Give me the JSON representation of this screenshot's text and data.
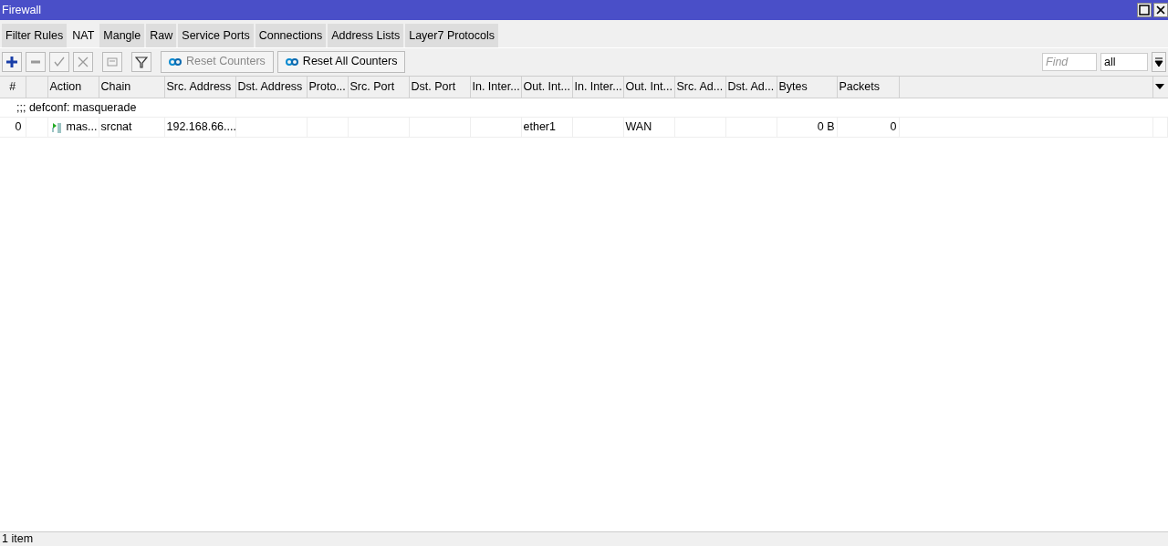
{
  "window": {
    "title": "Firewall"
  },
  "tabs": [
    {
      "label": "Filter Rules",
      "selected": false
    },
    {
      "label": "NAT",
      "selected": true
    },
    {
      "label": "Mangle",
      "selected": false
    },
    {
      "label": "Raw",
      "selected": false
    },
    {
      "label": "Service Ports",
      "selected": false
    },
    {
      "label": "Connections",
      "selected": false
    },
    {
      "label": "Address Lists",
      "selected": false
    },
    {
      "label": "Layer7 Protocols",
      "selected": false
    }
  ],
  "toolbar": {
    "tools": [
      {
        "kind": "add",
        "disabled": false
      },
      {
        "kind": "remove",
        "disabled": true
      },
      {
        "kind": "enable",
        "disabled": true
      },
      {
        "kind": "disable",
        "disabled": true
      },
      {
        "kind": "comment",
        "disabled": true
      },
      {
        "kind": "filter",
        "disabled": false
      }
    ],
    "buttons": [
      {
        "label": "Reset Counters",
        "disabled": true
      },
      {
        "label": "Reset All Counters",
        "disabled": false
      }
    ],
    "find": {
      "placeholder": "Find"
    },
    "scope": {
      "value": "all"
    }
  },
  "table": {
    "columns": [
      "#",
      "",
      "Action",
      "Chain",
      "Src. Address",
      "Dst. Address",
      "Proto...",
      "Src. Port",
      "Dst. Port",
      "In. Inter...",
      "Out. Int...",
      "In. Inter...",
      "Out. Int...",
      "Src. Ad...",
      "Dst. Ad...",
      "Bytes",
      "Packets"
    ],
    "rows": [
      {
        "kind": "comment",
        "text": ";;; defconf: masquerade"
      },
      {
        "kind": "rule",
        "cells": {
          "0": "0",
          "2": "mas...",
          "3": "srcnat",
          "4": "192.168.66....",
          "10": "ether1",
          "12": "WAN",
          "15": "0 B",
          "16": "0"
        }
      }
    ]
  },
  "status_bar": "1 item"
}
